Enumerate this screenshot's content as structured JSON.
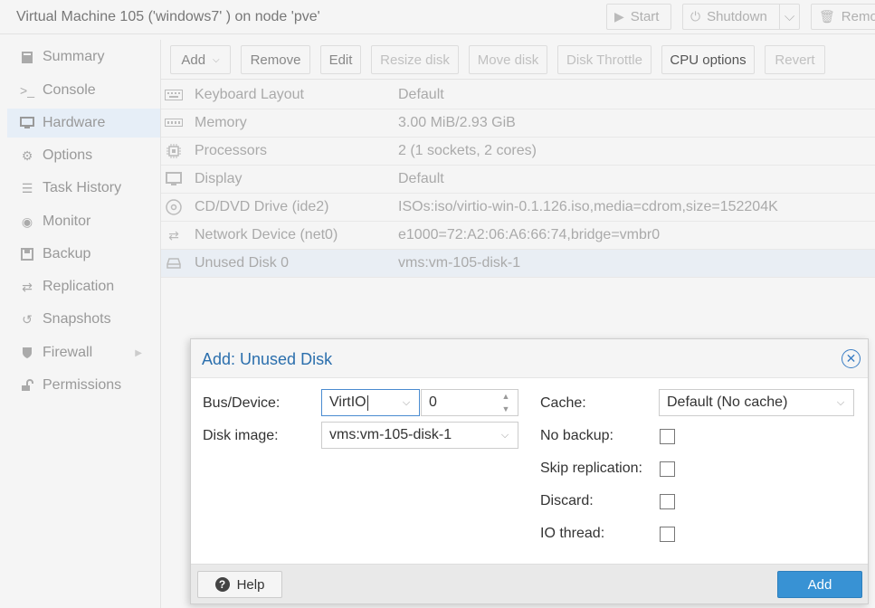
{
  "window": {
    "title": "Virtual Machine 105 ('windows7' ) on node 'pve'",
    "start_label": "Start",
    "shutdown_label": "Shutdown",
    "remove_label": "Remo"
  },
  "nav": {
    "items": [
      {
        "label": "Summary",
        "icon": "book-icon"
      },
      {
        "label": "Console",
        "icon": "terminal-icon"
      },
      {
        "label": "Hardware",
        "icon": "desktop-icon"
      },
      {
        "label": "Options",
        "icon": "gear-icon"
      },
      {
        "label": "Task History",
        "icon": "list-icon"
      },
      {
        "label": "Monitor",
        "icon": "eye-icon"
      },
      {
        "label": "Backup",
        "icon": "floppy-icon"
      },
      {
        "label": "Replication",
        "icon": "retweet-icon"
      },
      {
        "label": "Snapshots",
        "icon": "history-icon"
      },
      {
        "label": "Firewall",
        "icon": "shield-icon"
      },
      {
        "label": "Permissions",
        "icon": "unlock-icon"
      }
    ],
    "active": "Hardware"
  },
  "toolbar": {
    "add": "Add",
    "remove": "Remove",
    "edit": "Edit",
    "resize": "Resize disk",
    "move": "Move disk",
    "throttle": "Disk Throttle",
    "cpu": "CPU options",
    "revert": "Revert"
  },
  "hardware": [
    {
      "label": "Keyboard Layout",
      "value": "Default",
      "icon": "keyboard-icon"
    },
    {
      "label": "Memory",
      "value": "3.00 MiB/2.93 GiB",
      "icon": "memory-icon"
    },
    {
      "label": "Processors",
      "value": "2 (1 sockets, 2 cores)",
      "icon": "cpu-icon"
    },
    {
      "label": "Display",
      "value": "Default",
      "icon": "monitor-icon"
    },
    {
      "label": "CD/DVD Drive (ide2)",
      "value": "ISOs:iso/virtio-win-0.1.126.iso,media=cdrom,size=152204K",
      "icon": "cdrom-icon"
    },
    {
      "label": "Network Device (net0)",
      "value": "e1000=72:A2:06:A6:66:74,bridge=vmbr0",
      "icon": "exchange-icon"
    },
    {
      "label": "Unused Disk 0",
      "value": "vms:vm-105-disk-1",
      "icon": "hdd-icon"
    }
  ],
  "dialog": {
    "title": "Add: Unused Disk",
    "bus_label": "Bus/Device:",
    "bus_value": "VirtIO",
    "device_value": "0",
    "disk_image_label": "Disk image:",
    "disk_image_value": "vms:vm-105-disk-1",
    "cache_label": "Cache:",
    "cache_value": "Default (No cache)",
    "no_backup_label": "No backup:",
    "skip_replication_label": "Skip replication:",
    "discard_label": "Discard:",
    "io_thread_label": "IO thread:",
    "help_label": "Help",
    "add_label": "Add"
  }
}
